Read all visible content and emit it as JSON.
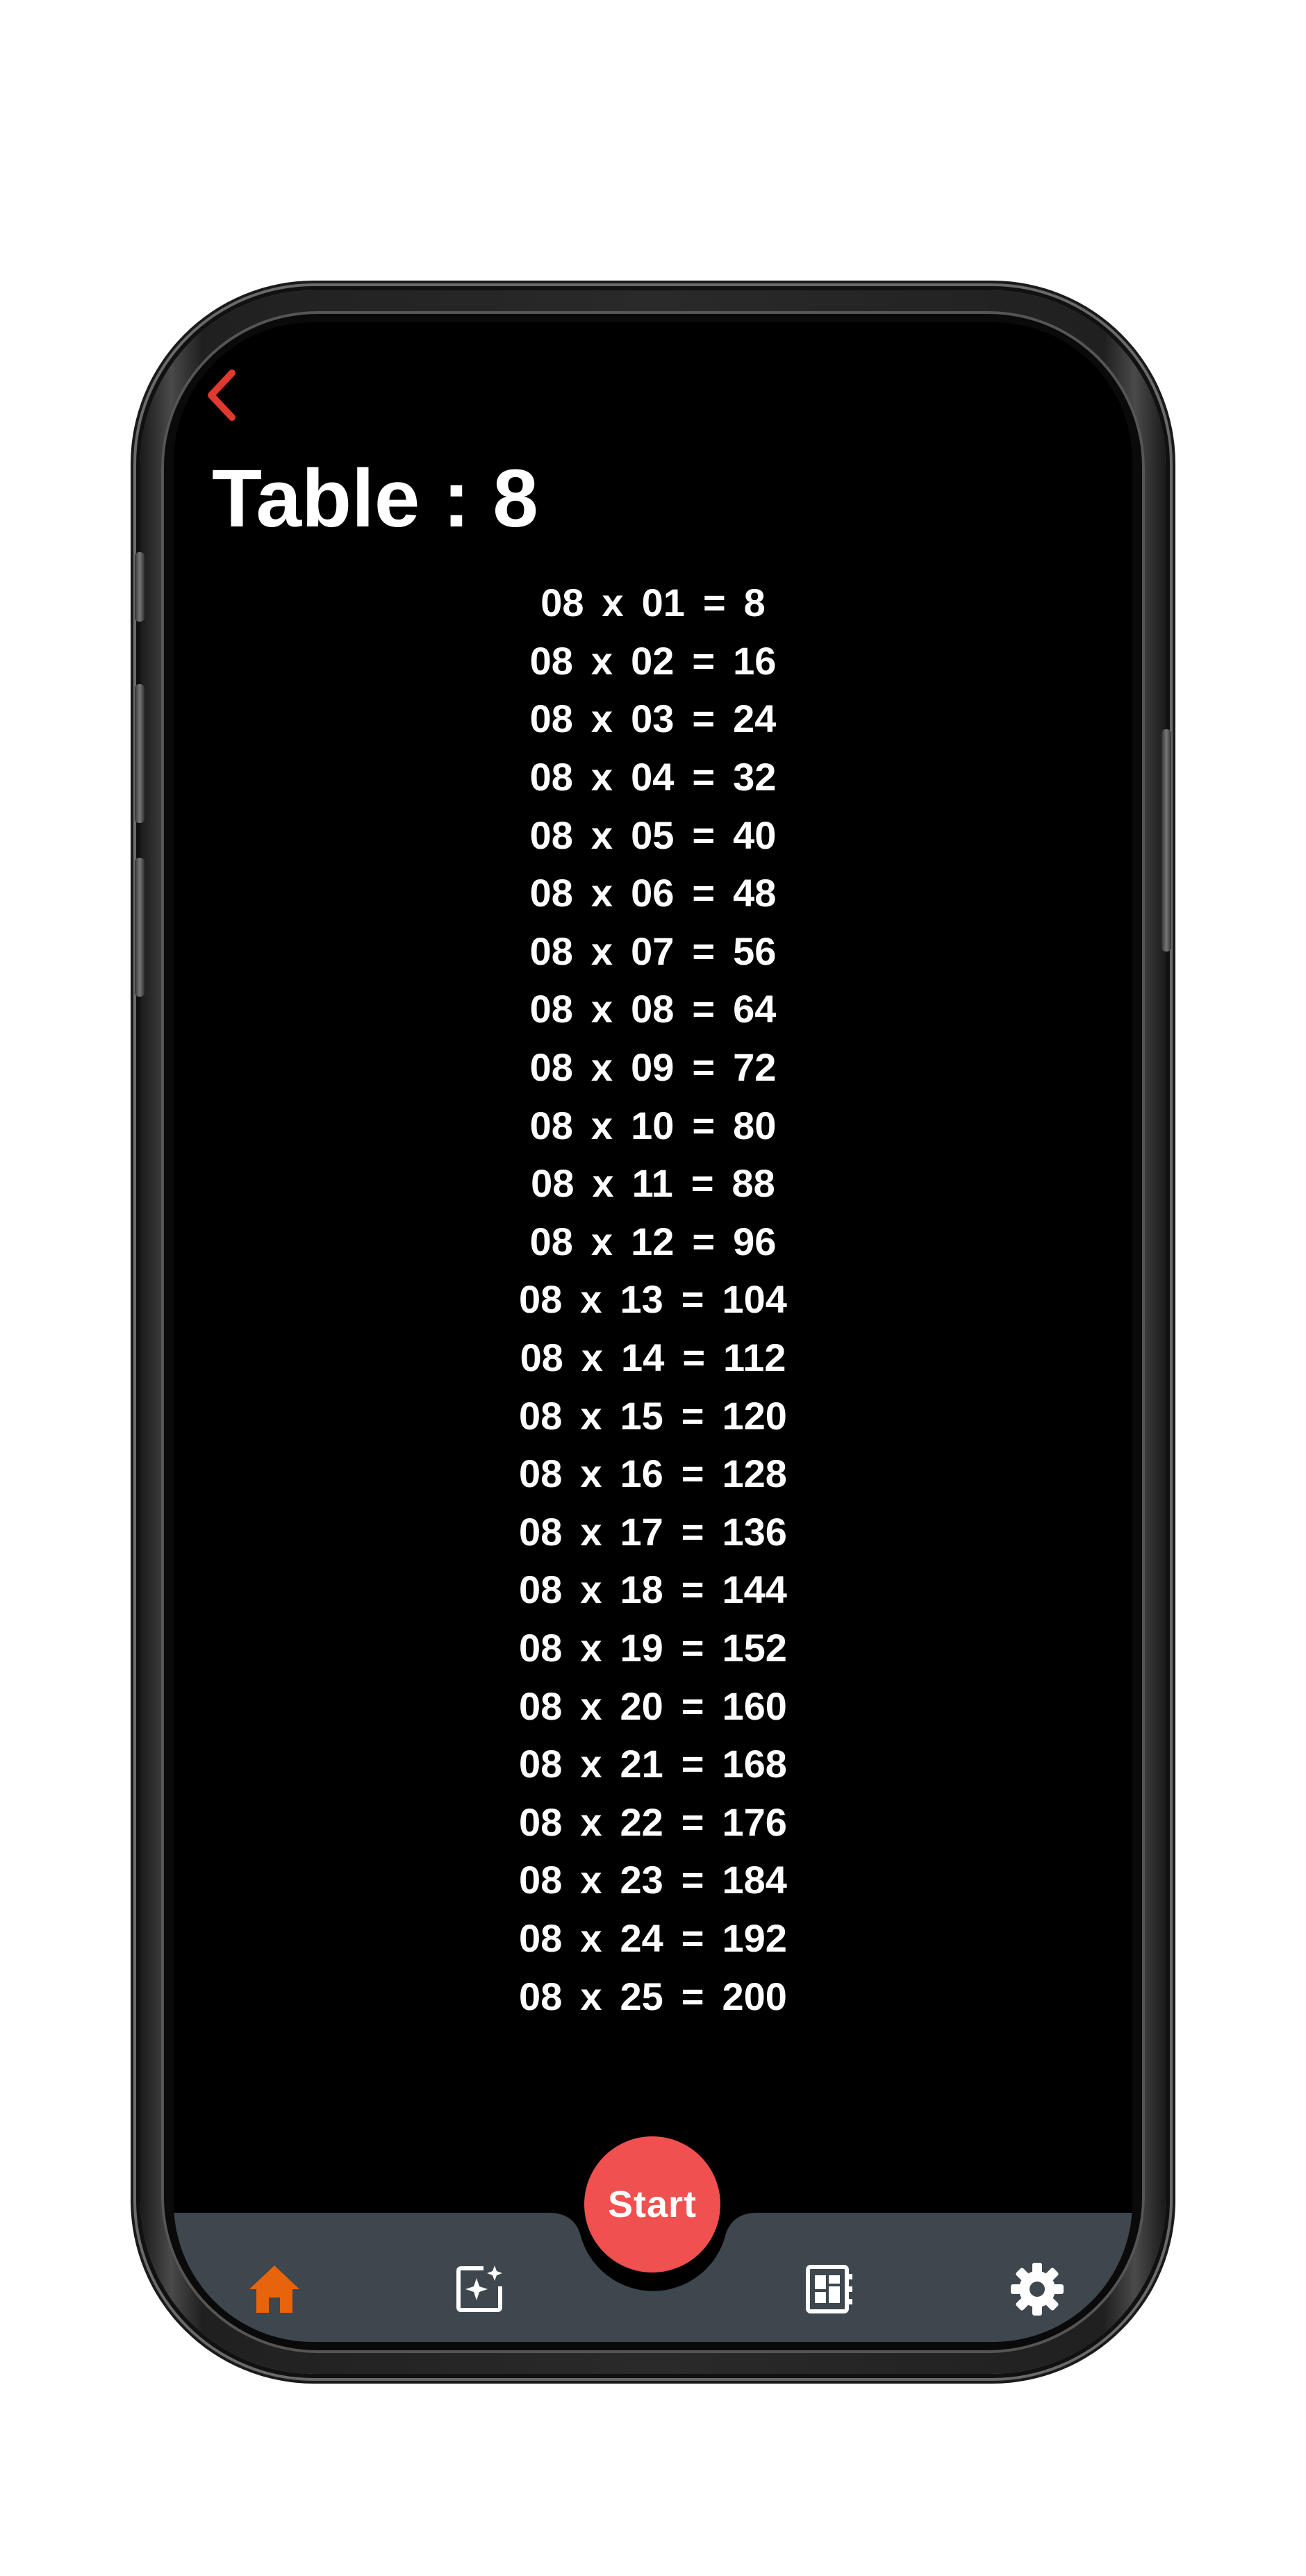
{
  "header": {
    "title": "Table : 8"
  },
  "table": {
    "rows": [
      {
        "a": "08",
        "op": "x",
        "b": "01",
        "eq": "=",
        "result": "8"
      },
      {
        "a": "08",
        "op": "x",
        "b": "02",
        "eq": "=",
        "result": "16"
      },
      {
        "a": "08",
        "op": "x",
        "b": "03",
        "eq": "=",
        "result": "24"
      },
      {
        "a": "08",
        "op": "x",
        "b": "04",
        "eq": "=",
        "result": "32"
      },
      {
        "a": "08",
        "op": "x",
        "b": "05",
        "eq": "=",
        "result": "40"
      },
      {
        "a": "08",
        "op": "x",
        "b": "06",
        "eq": "=",
        "result": "48"
      },
      {
        "a": "08",
        "op": "x",
        "b": "07",
        "eq": "=",
        "result": "56"
      },
      {
        "a": "08",
        "op": "x",
        "b": "08",
        "eq": "=",
        "result": "64"
      },
      {
        "a": "08",
        "op": "x",
        "b": "09",
        "eq": "=",
        "result": "72"
      },
      {
        "a": "08",
        "op": "x",
        "b": "10",
        "eq": "=",
        "result": "80"
      },
      {
        "a": "08",
        "op": "x",
        "b": "11",
        "eq": "=",
        "result": "88"
      },
      {
        "a": "08",
        "op": "x",
        "b": "12",
        "eq": "=",
        "result": "96"
      },
      {
        "a": "08",
        "op": "x",
        "b": "13",
        "eq": "=",
        "result": "104"
      },
      {
        "a": "08",
        "op": "x",
        "b": "14",
        "eq": "=",
        "result": "112"
      },
      {
        "a": "08",
        "op": "x",
        "b": "15",
        "eq": "=",
        "result": "120"
      },
      {
        "a": "08",
        "op": "x",
        "b": "16",
        "eq": "=",
        "result": "128"
      },
      {
        "a": "08",
        "op": "x",
        "b": "17",
        "eq": "=",
        "result": "136"
      },
      {
        "a": "08",
        "op": "x",
        "b": "18",
        "eq": "=",
        "result": "144"
      },
      {
        "a": "08",
        "op": "x",
        "b": "19",
        "eq": "=",
        "result": "152"
      },
      {
        "a": "08",
        "op": "x",
        "b": "20",
        "eq": "=",
        "result": "160"
      },
      {
        "a": "08",
        "op": "x",
        "b": "21",
        "eq": "=",
        "result": "168"
      },
      {
        "a": "08",
        "op": "x",
        "b": "22",
        "eq": "=",
        "result": "176"
      },
      {
        "a": "08",
        "op": "x",
        "b": "23",
        "eq": "=",
        "result": "184"
      },
      {
        "a": "08",
        "op": "x",
        "b": "24",
        "eq": "=",
        "result": "192"
      },
      {
        "a": "08",
        "op": "x",
        "b": "25",
        "eq": "=",
        "result": "200"
      }
    ]
  },
  "nav": {
    "start_label": "Start",
    "items": [
      {
        "icon": "home-icon",
        "active": true
      },
      {
        "icon": "sparkle-card-icon",
        "active": false
      },
      {
        "icon": "dashboard-book-icon",
        "active": false
      },
      {
        "icon": "gear-icon",
        "active": false
      }
    ]
  },
  "colors": {
    "background": "#000000",
    "text": "#ffffff",
    "back_arrow": "#e03a2f",
    "start_button": "#f05150",
    "nav_bar": "#3d474d",
    "nav_active": "#e8640c",
    "nav_inactive": "#ffffff"
  }
}
